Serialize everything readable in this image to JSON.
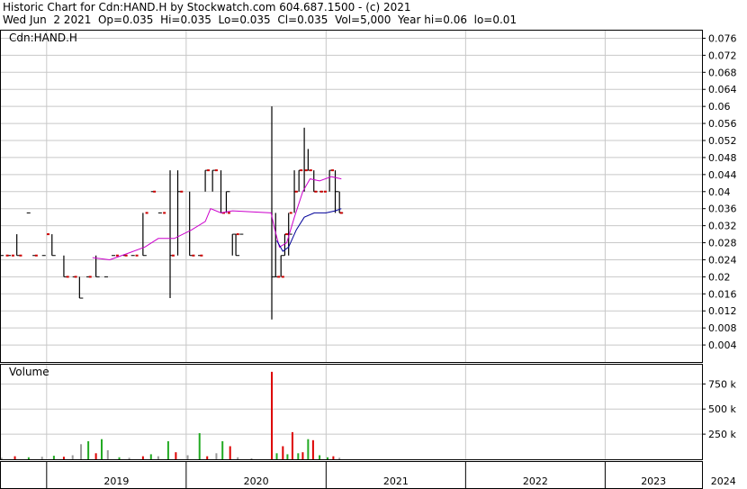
{
  "header": {
    "line1": "Historic Chart for Cdn:HAND.H by Stockwatch.com 604.687.1500 - (c) 2021",
    "line2": "Wed Jun  2 2021  Op=0.035  Hi=0.035  Lo=0.035  Cl=0.035  Vol=5,000  Year hi=0.06  lo=0.01"
  },
  "colors": {
    "grid": "#c8c8c8",
    "frame": "#000000",
    "bar": "#000000",
    "close_dot": "#cc0000",
    "ma_short": "#cc00cc",
    "ma_long": "#000099",
    "vol_up": "#22aa22",
    "vol_down": "#dd0000",
    "vol_flat": "#999999"
  },
  "chart_data": [
    {
      "type": "line",
      "title": "Cdn:HAND.H",
      "ylim": [
        0,
        0.078
      ],
      "yticks": [
        "0.004",
        "0.008",
        "0.012",
        "0.016",
        "0.02",
        "0.024",
        "0.028",
        "0.032",
        "0.036",
        "0.04",
        "0.044",
        "0.048",
        "0.052",
        "0.056",
        "0.06",
        "0.064",
        "0.068",
        "0.072",
        "0.076"
      ],
      "grid": true,
      "x_start": "2018-09-01",
      "x_categories": [
        "2019",
        "2020",
        "2021",
        "2022",
        "2023",
        "2024"
      ],
      "ohlc": [
        {
          "d": "2018-09-01",
          "h": 0.03,
          "l": 0.025,
          "c": 0.025
        },
        {
          "d": "2018-09-20",
          "h": 0.025,
          "l": 0.025,
          "c": 0.025
        },
        {
          "d": "2018-10-15",
          "h": 0.03,
          "l": 0.025,
          "c": 0.025
        },
        {
          "d": "2018-11-10",
          "h": 0.035,
          "l": 0.035,
          "c": 0.035
        },
        {
          "d": "2018-11-25",
          "h": 0.025,
          "l": 0.025,
          "c": 0.025
        },
        {
          "d": "2018-12-20",
          "h": 0.025,
          "l": 0.025,
          "c": 0.025
        },
        {
          "d": "2019-01-15",
          "h": 0.03,
          "l": 0.025,
          "c": 0.025
        },
        {
          "d": "2019-02-15",
          "h": 0.025,
          "l": 0.02,
          "c": 0.02
        },
        {
          "d": "2019-03-10",
          "h": 0.02,
          "l": 0.02,
          "c": 0.02
        },
        {
          "d": "2019-03-28",
          "h": 0.02,
          "l": 0.015,
          "c": 0.015
        },
        {
          "d": "2019-04-15",
          "h": 0.02,
          "l": 0.02,
          "c": 0.02
        },
        {
          "d": "2019-05-10",
          "h": 0.025,
          "l": 0.02,
          "c": 0.02
        },
        {
          "d": "2019-06-01",
          "h": 0.02,
          "l": 0.02,
          "c": 0.02
        },
        {
          "d": "2019-06-20",
          "h": 0.025,
          "l": 0.025,
          "c": 0.025
        },
        {
          "d": "2019-07-20",
          "h": 0.025,
          "l": 0.025,
          "c": 0.025
        },
        {
          "d": "2019-08-10",
          "h": 0.025,
          "l": 0.025,
          "c": 0.025
        },
        {
          "d": "2019-09-10",
          "h": 0.035,
          "l": 0.025,
          "c": 0.025
        },
        {
          "d": "2019-10-01",
          "h": 0.04,
          "l": 0.04,
          "c": 0.04
        },
        {
          "d": "2019-10-20",
          "h": 0.035,
          "l": 0.035,
          "c": 0.035
        },
        {
          "d": "2019-11-20",
          "h": 0.045,
          "l": 0.015,
          "c": 0.025
        },
        {
          "d": "2019-12-10",
          "h": 0.045,
          "l": 0.025,
          "c": 0.04
        },
        {
          "d": "2020-01-10",
          "h": 0.04,
          "l": 0.025,
          "c": 0.025
        },
        {
          "d": "2020-02-01",
          "h": 0.025,
          "l": 0.025,
          "c": 0.025
        },
        {
          "d": "2020-02-20",
          "h": 0.045,
          "l": 0.04,
          "c": 0.045
        },
        {
          "d": "2020-03-10",
          "h": 0.045,
          "l": 0.04,
          "c": 0.045
        },
        {
          "d": "2020-04-01",
          "h": 0.045,
          "l": 0.035,
          "c": 0.035
        },
        {
          "d": "2020-04-15",
          "h": 0.04,
          "l": 0.035,
          "c": 0.04
        },
        {
          "d": "2020-05-01",
          "h": 0.03,
          "l": 0.025,
          "c": 0.03
        },
        {
          "d": "2020-05-10",
          "h": 0.03,
          "l": 0.025,
          "c": 0.025
        },
        {
          "d": "2020-05-20",
          "h": 0.03,
          "l": 0.03,
          "c": 0.03
        },
        {
          "d": "2020-08-12",
          "h": 0.06,
          "l": 0.01,
          "c": 0.02
        },
        {
          "d": "2020-08-22",
          "h": 0.035,
          "l": 0.02,
          "c": 0.02
        },
        {
          "d": "2020-09-05",
          "h": 0.025,
          "l": 0.02,
          "c": 0.025
        },
        {
          "d": "2020-09-15",
          "h": 0.03,
          "l": 0.025,
          "c": 0.03
        },
        {
          "d": "2020-09-25",
          "h": 0.035,
          "l": 0.025,
          "c": 0.03
        },
        {
          "d": "2020-10-10",
          "h": 0.045,
          "l": 0.035,
          "c": 0.04
        },
        {
          "d": "2020-10-22",
          "h": 0.045,
          "l": 0.04,
          "c": 0.045
        },
        {
          "d": "2020-11-05",
          "h": 0.055,
          "l": 0.04,
          "c": 0.045
        },
        {
          "d": "2020-11-15",
          "h": 0.05,
          "l": 0.045,
          "c": 0.045
        },
        {
          "d": "2020-11-30",
          "h": 0.045,
          "l": 0.04,
          "c": 0.04
        },
        {
          "d": "2020-12-15",
          "h": 0.04,
          "l": 0.04,
          "c": 0.04
        },
        {
          "d": "2021-01-10",
          "h": 0.045,
          "l": 0.04,
          "c": 0.045
        },
        {
          "d": "2021-01-25",
          "h": 0.045,
          "l": 0.035,
          "c": 0.04
        },
        {
          "d": "2021-02-05",
          "h": 0.04,
          "l": 0.035,
          "c": 0.035
        }
      ],
      "close_dots": [
        {
          "d": "2018-09-20",
          "v": 0.025
        },
        {
          "d": "2018-10-05",
          "v": 0.025
        },
        {
          "d": "2018-10-25",
          "v": 0.025
        },
        {
          "d": "2018-12-05",
          "v": 0.025
        },
        {
          "d": "2019-01-05",
          "v": 0.03
        },
        {
          "d": "2019-02-25",
          "v": 0.02
        },
        {
          "d": "2019-03-18",
          "v": 0.02
        },
        {
          "d": "2019-04-25",
          "v": 0.02
        },
        {
          "d": "2019-07-05",
          "v": 0.025
        },
        {
          "d": "2019-07-28",
          "v": 0.025
        },
        {
          "d": "2019-08-25",
          "v": 0.025
        },
        {
          "d": "2019-09-20",
          "v": 0.035
        },
        {
          "d": "2019-10-10",
          "v": 0.04
        },
        {
          "d": "2019-11-05",
          "v": 0.035
        },
        {
          "d": "2019-11-28",
          "v": 0.025
        },
        {
          "d": "2019-12-20",
          "v": 0.04
        },
        {
          "d": "2020-01-20",
          "v": 0.025
        },
        {
          "d": "2020-02-10",
          "v": 0.025
        },
        {
          "d": "2020-02-28",
          "v": 0.045
        },
        {
          "d": "2020-03-20",
          "v": 0.045
        },
        {
          "d": "2020-04-08",
          "v": 0.035
        },
        {
          "d": "2020-04-22",
          "v": 0.035
        },
        {
          "d": "2020-05-15",
          "v": 0.03
        },
        {
          "d": "2020-08-30",
          "v": 0.02
        },
        {
          "d": "2020-09-10",
          "v": 0.02
        },
        {
          "d": "2020-09-20",
          "v": 0.03
        },
        {
          "d": "2020-10-01",
          "v": 0.035
        },
        {
          "d": "2020-10-15",
          "v": 0.04
        },
        {
          "d": "2020-10-28",
          "v": 0.045
        },
        {
          "d": "2020-11-10",
          "v": 0.045
        },
        {
          "d": "2020-11-22",
          "v": 0.045
        },
        {
          "d": "2020-12-05",
          "v": 0.04
        },
        {
          "d": "2020-12-20",
          "v": 0.04
        },
        {
          "d": "2020-12-30",
          "v": 0.04
        },
        {
          "d": "2021-01-18",
          "v": 0.045
        },
        {
          "d": "2021-02-10",
          "v": 0.035
        }
      ],
      "ma_short": [
        {
          "d": "2019-05-01",
          "v": 0.0245
        },
        {
          "d": "2019-06-15",
          "v": 0.024
        },
        {
          "d": "2019-08-01",
          "v": 0.0255
        },
        {
          "d": "2019-09-15",
          "v": 0.027
        },
        {
          "d": "2019-10-20",
          "v": 0.029
        },
        {
          "d": "2019-12-01",
          "v": 0.029
        },
        {
          "d": "2020-01-15",
          "v": 0.031
        },
        {
          "d": "2020-02-20",
          "v": 0.033
        },
        {
          "d": "2020-03-05",
          "v": 0.036
        },
        {
          "d": "2020-04-01",
          "v": 0.035
        },
        {
          "d": "2020-05-01",
          "v": 0.0355
        },
        {
          "d": "2020-08-10",
          "v": 0.035
        },
        {
          "d": "2020-08-20",
          "v": 0.031
        },
        {
          "d": "2020-09-01",
          "v": 0.027
        },
        {
          "d": "2020-09-20",
          "v": 0.028
        },
        {
          "d": "2020-10-10",
          "v": 0.034
        },
        {
          "d": "2020-11-01",
          "v": 0.04
        },
        {
          "d": "2020-11-20",
          "v": 0.043
        },
        {
          "d": "2020-12-15",
          "v": 0.0425
        },
        {
          "d": "2021-01-15",
          "v": 0.0435
        },
        {
          "d": "2021-02-10",
          "v": 0.043
        }
      ],
      "ma_long": [
        {
          "d": "2020-08-25",
          "v": 0.0285
        },
        {
          "d": "2020-09-10",
          "v": 0.026
        },
        {
          "d": "2020-09-25",
          "v": 0.027
        },
        {
          "d": "2020-10-15",
          "v": 0.031
        },
        {
          "d": "2020-11-05",
          "v": 0.034
        },
        {
          "d": "2020-12-01",
          "v": 0.035
        },
        {
          "d": "2021-01-01",
          "v": 0.035
        },
        {
          "d": "2021-01-25",
          "v": 0.0355
        },
        {
          "d": "2021-02-10",
          "v": 0.036
        }
      ]
    },
    {
      "type": "bar",
      "title": "Volume",
      "ylim": [
        0,
        950000
      ],
      "yticks": [
        "250 k",
        "500 k",
        "750 k"
      ],
      "grid": true,
      "bars": [
        {
          "d": "2018-09-05",
          "v": 15000,
          "dir": "flat"
        },
        {
          "d": "2018-10-10",
          "v": 30000,
          "dir": "down"
        },
        {
          "d": "2018-11-15",
          "v": 20000,
          "dir": "up"
        },
        {
          "d": "2018-12-20",
          "v": 25000,
          "dir": "flat"
        },
        {
          "d": "2019-01-20",
          "v": 35000,
          "dir": "up"
        },
        {
          "d": "2019-02-15",
          "v": 25000,
          "dir": "down"
        },
        {
          "d": "2019-03-10",
          "v": 40000,
          "dir": "flat"
        },
        {
          "d": "2019-04-01",
          "v": 150000,
          "dir": "flat"
        },
        {
          "d": "2019-04-20",
          "v": 180000,
          "dir": "up"
        },
        {
          "d": "2019-05-10",
          "v": 60000,
          "dir": "down"
        },
        {
          "d": "2019-05-25",
          "v": 200000,
          "dir": "up"
        },
        {
          "d": "2019-06-10",
          "v": 90000,
          "dir": "flat"
        },
        {
          "d": "2019-07-10",
          "v": 20000,
          "dir": "up"
        },
        {
          "d": "2019-08-05",
          "v": 15000,
          "dir": "flat"
        },
        {
          "d": "2019-09-10",
          "v": 30000,
          "dir": "down"
        },
        {
          "d": "2019-10-01",
          "v": 50000,
          "dir": "up"
        },
        {
          "d": "2019-10-20",
          "v": 30000,
          "dir": "flat"
        },
        {
          "d": "2019-11-15",
          "v": 180000,
          "dir": "up"
        },
        {
          "d": "2019-12-05",
          "v": 70000,
          "dir": "down"
        },
        {
          "d": "2020-01-05",
          "v": 40000,
          "dir": "flat"
        },
        {
          "d": "2020-02-05",
          "v": 260000,
          "dir": "up"
        },
        {
          "d": "2020-02-25",
          "v": 30000,
          "dir": "down"
        },
        {
          "d": "2020-03-20",
          "v": 60000,
          "dir": "flat"
        },
        {
          "d": "2020-04-05",
          "v": 180000,
          "dir": "up"
        },
        {
          "d": "2020-04-25",
          "v": 130000,
          "dir": "down"
        },
        {
          "d": "2020-05-15",
          "v": 20000,
          "dir": "flat"
        },
        {
          "d": "2020-06-20",
          "v": 10000,
          "dir": "flat"
        },
        {
          "d": "2020-08-12",
          "v": 870000,
          "dir": "down"
        },
        {
          "d": "2020-08-25",
          "v": 60000,
          "dir": "up"
        },
        {
          "d": "2020-09-10",
          "v": 130000,
          "dir": "down"
        },
        {
          "d": "2020-09-22",
          "v": 50000,
          "dir": "up"
        },
        {
          "d": "2020-10-05",
          "v": 270000,
          "dir": "down"
        },
        {
          "d": "2020-10-20",
          "v": 60000,
          "dir": "up"
        },
        {
          "d": "2020-11-01",
          "v": 70000,
          "dir": "down"
        },
        {
          "d": "2020-11-15",
          "v": 200000,
          "dir": "up"
        },
        {
          "d": "2020-11-28",
          "v": 190000,
          "dir": "down"
        },
        {
          "d": "2020-12-15",
          "v": 40000,
          "dir": "up"
        },
        {
          "d": "2021-01-05",
          "v": 20000,
          "dir": "up"
        },
        {
          "d": "2021-01-20",
          "v": 30000,
          "dir": "down"
        },
        {
          "d": "2021-02-05",
          "v": 15000,
          "dir": "flat"
        }
      ]
    }
  ]
}
